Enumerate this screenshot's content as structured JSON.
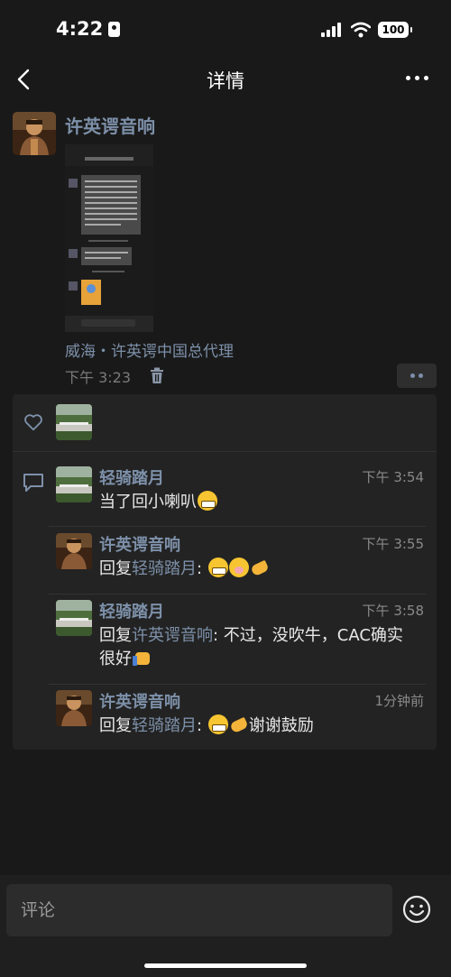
{
  "status": {
    "time": "4:22",
    "battery": "100"
  },
  "nav": {
    "title": "详情"
  },
  "post": {
    "author": "许英谔音响",
    "location": "威海・许英谔中国总代理",
    "time": "下午 3:23"
  },
  "comments": [
    {
      "name": "轻骑踏月",
      "time": "下午 3:54",
      "reply_prefix": "",
      "reply_to": "",
      "text": "当了回小喇叭",
      "emojis": [
        "grin"
      ]
    },
    {
      "name": "许英谔音响",
      "time": "下午 3:55",
      "reply_prefix": "回复",
      "reply_to": "轻骑踏月",
      "text": ": ",
      "emojis": [
        "grin",
        "yawn",
        "hand"
      ]
    },
    {
      "name": "轻骑踏月",
      "time": "下午 3:58",
      "reply_prefix": "回复",
      "reply_to": "许英谔音响",
      "text": ": 不过，没吹牛，CAC确实很好",
      "emojis": [
        "thumb"
      ]
    },
    {
      "name": "许英谔音响",
      "time": "1分钟前",
      "reply_prefix": "回复",
      "reply_to": "轻骑踏月",
      "text": ": ",
      "emojis": [
        "grin",
        "hand"
      ],
      "text_after": "谢谢鼓励"
    }
  ],
  "input": {
    "placeholder": "评论"
  },
  "colors": {
    "link": "#7d90a9",
    "background": "#191919"
  }
}
